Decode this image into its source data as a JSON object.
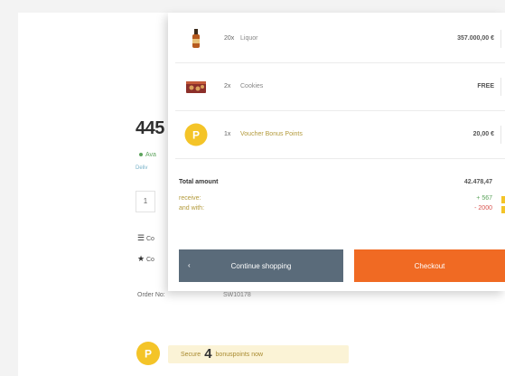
{
  "cart": {
    "items": [
      {
        "qty": "20x",
        "name": "Liquor",
        "price": "357.000,00 €",
        "icon": "bottle-icon"
      },
      {
        "qty": "2x",
        "name": "Cookies",
        "price": "FREE",
        "icon": "cookie-box-icon"
      },
      {
        "qty": "1x",
        "name": "Voucher Bonus Points",
        "price": "20,00 €",
        "icon": "bonus-coin-icon",
        "coin_letter": "P"
      }
    ],
    "total_label": "Total amount",
    "total_value": "42.478,47",
    "receive_label": "receive:",
    "receive_value": "+ 567",
    "spend_label": "and with:",
    "spend_value": "- 2000",
    "continue_label": "Continue shopping",
    "continue_icon": "chevron-left-icon",
    "checkout_label": "Checkout"
  },
  "product": {
    "price_fragment": "445",
    "stock_fragment": "Ava",
    "delivery_fragment": "Deliv",
    "quantity": "1",
    "compare_fragment": "Co",
    "wishlist_fragment": "Co",
    "order_no_label": "Order No:",
    "order_no_value": "SW10178"
  },
  "bonus": {
    "coin_letter": "P",
    "prefix": "Secure",
    "points": "4",
    "suffix": "bonuspoints now"
  },
  "colors": {
    "accent_orange": "#f06a23",
    "button_slate": "#5a6b7a",
    "coin_yellow": "#f4c428",
    "points_positive": "#5aa35a",
    "points_negative": "#d9534f"
  }
}
